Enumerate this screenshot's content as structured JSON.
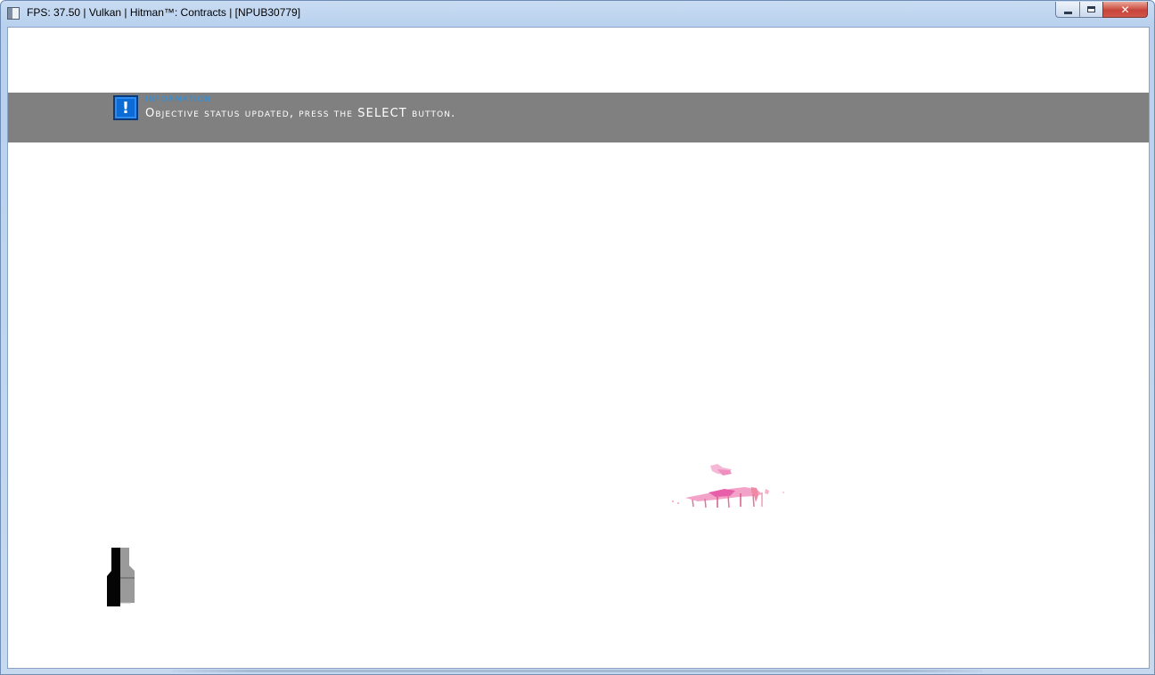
{
  "window": {
    "title": "FPS: 37.50 | Vulkan | Hitman™: Contracts | [NPUB30779]",
    "app_icon": "app-window-icon",
    "buttons": {
      "minimize": "minimize-icon",
      "maximize": "maximize-icon",
      "close": "close-icon"
    }
  },
  "notification": {
    "icon": "exclamation-icon",
    "icon_glyph": "!",
    "heading": "INFORMATION",
    "message": "Objective status updated, press the SELECT button.",
    "bar_color": "#808080",
    "heading_color": "#2a8fe0",
    "icon_color": "#0d6bd6"
  },
  "colors": {
    "client_background": "#ffffff",
    "frame": "#c0d4ee",
    "close_button": "#c8453b"
  }
}
